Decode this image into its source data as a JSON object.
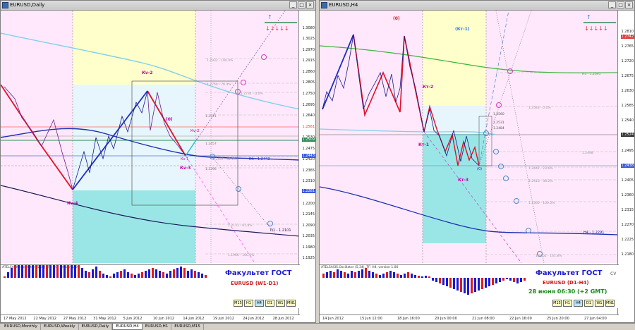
{
  "left": {
    "title": "EURUSD,Daily",
    "prices": [
      "1.3080",
      "1.3025",
      "1.2970",
      "1.2915",
      "1.2860",
      "1.2805",
      "1.2750",
      "1.2695",
      "1.2640",
      "1.2581",
      "1.2530",
      "1.2475",
      "1.2420",
      "1.2365",
      "1.2310",
      "1.2255",
      "1.2200",
      "1.2145",
      "1.2090",
      "1.2035",
      "1.1980",
      "1.1925"
    ],
    "price_tags": [
      {
        "value": "1.2581",
        "color": "#ff3a3a"
      },
      {
        "value": "1.2509",
        "color": "#ffffff",
        "bg": "#2e8b57"
      },
      {
        "value": "1.2443",
        "color": "#ffffff",
        "bg": "#3b5bdb"
      },
      {
        "value": "1.2281",
        "color": "#ffffff",
        "bg": "#3b5bdb"
      }
    ],
    "osc_label": "ATELSASIS.Oscillator (5,34), TF: D1, version 1.00",
    "osc_values": [
      "0.00178",
      "-0.00000",
      "-0.00178"
    ],
    "dates": [
      "17 May 2012",
      "22 May 2012",
      "27 May 2012",
      "31 May 2012",
      "5 Jun 2012",
      "10 Jun 2012",
      "14 Jun 2012",
      "19 Jun 2012",
      "24 Jun 2012",
      "28 Jun 2012"
    ],
    "wave_labels": {
      "kv2": "Кv-2",
      "kv4": "Кv-4",
      "kv3": "Кv-3",
      "kv0": "(0)",
      "kv": "Кv-2",
      "kvv": "Кv-1"
    },
    "levels": {
      "l1": "1.2932 - 100.0%",
      "l2": "1.2750 - 76.4%",
      "l3": "1.2734 - 0.0%",
      "l4": "1.2571",
      "l5": "1.2457",
      "l6": "1.2437 - 61.8%",
      "l7": "D1 - 1.2443",
      "l8": "1.2396",
      "l9": "1.2131 - 61.8%",
      "l10": "D1 - 1.2101",
      "l11": "1.1966 - 100.0%"
    },
    "brand": "Факультет ГОСТ",
    "subtitle": "EURUSD (W1-D1)",
    "tf_buttons": [
      "M15",
      "H1",
      "H4",
      "D1",
      "W1",
      "MN1"
    ],
    "tf_active": "H4"
  },
  "right": {
    "title": "EURUSD,H4",
    "prices": [
      "1.2810",
      "1.2765",
      "1.2720",
      "1.2675",
      "1.2630",
      "1.2585",
      "1.2540",
      "1.2524",
      "1.2495",
      "1.2450",
      "1.2405",
      "1.2360",
      "1.2315",
      "1.2270",
      "1.2225",
      "1.2180"
    ],
    "price_tags": [
      {
        "value": "1.2742",
        "color": "#ffffff",
        "bg": "#e03a3a"
      },
      {
        "value": "1.2524",
        "color": "#ffffff",
        "bg": "#333333"
      },
      {
        "value": "1.2438",
        "color": "#ffffff",
        "bg": "#3b5bdb"
      }
    ],
    "osc_label": "ATELSASIS.Oscillator (5,34), TF: H4, version 1.00",
    "dates": [
      "14 Jun 2012",
      "15 Jun 12:00",
      "18 Jun 16:00",
      "20 Jun 00:00",
      "21 Jun 08:00",
      "22 Jun 16:00",
      "25 Jun 20:00",
      "27 Jun 04:00"
    ],
    "wave_labels": {
      "k0": "(0)",
      "k1": "(Кт-1)",
      "k2": "Кт-2",
      "k3": "Кт-1",
      "k4": "Кт-3",
      "k5": "(0)"
    },
    "levels": {
      "h1": "H4 - 1.2661",
      "h2": "1.2583 - 0.0%",
      "h3": "1.2560",
      "h4": "1.2531",
      "h5": "1.2484",
      "h6": "1.2498",
      "h7": "1.2442 - 23.6%",
      "h8": "1.2413 - 38.2%",
      "h9": "1.2360 - 100.0%",
      "h10": "H4 - 1.2291",
      "h11": "1.2202 - 161.8%"
    },
    "brand": "Факультет ГОСТ",
    "subtitle": "EURUSD (D1-H4)",
    "date_note": "28 июня 06:30 (+2 GMT)",
    "tf_buttons": [
      "M15",
      "H1",
      "H4",
      "D1",
      "W1",
      "MN1"
    ],
    "tf_active": "H4",
    "cv": "CV"
  },
  "tabs": [
    "EURUSD,Monthly",
    "EURUSD,Weekly",
    "EURUSD,Daily",
    "EURUSD,H4",
    "EURUSD,H1",
    "EURUSD,M15"
  ],
  "active_tab": "EURUSD,H4"
}
